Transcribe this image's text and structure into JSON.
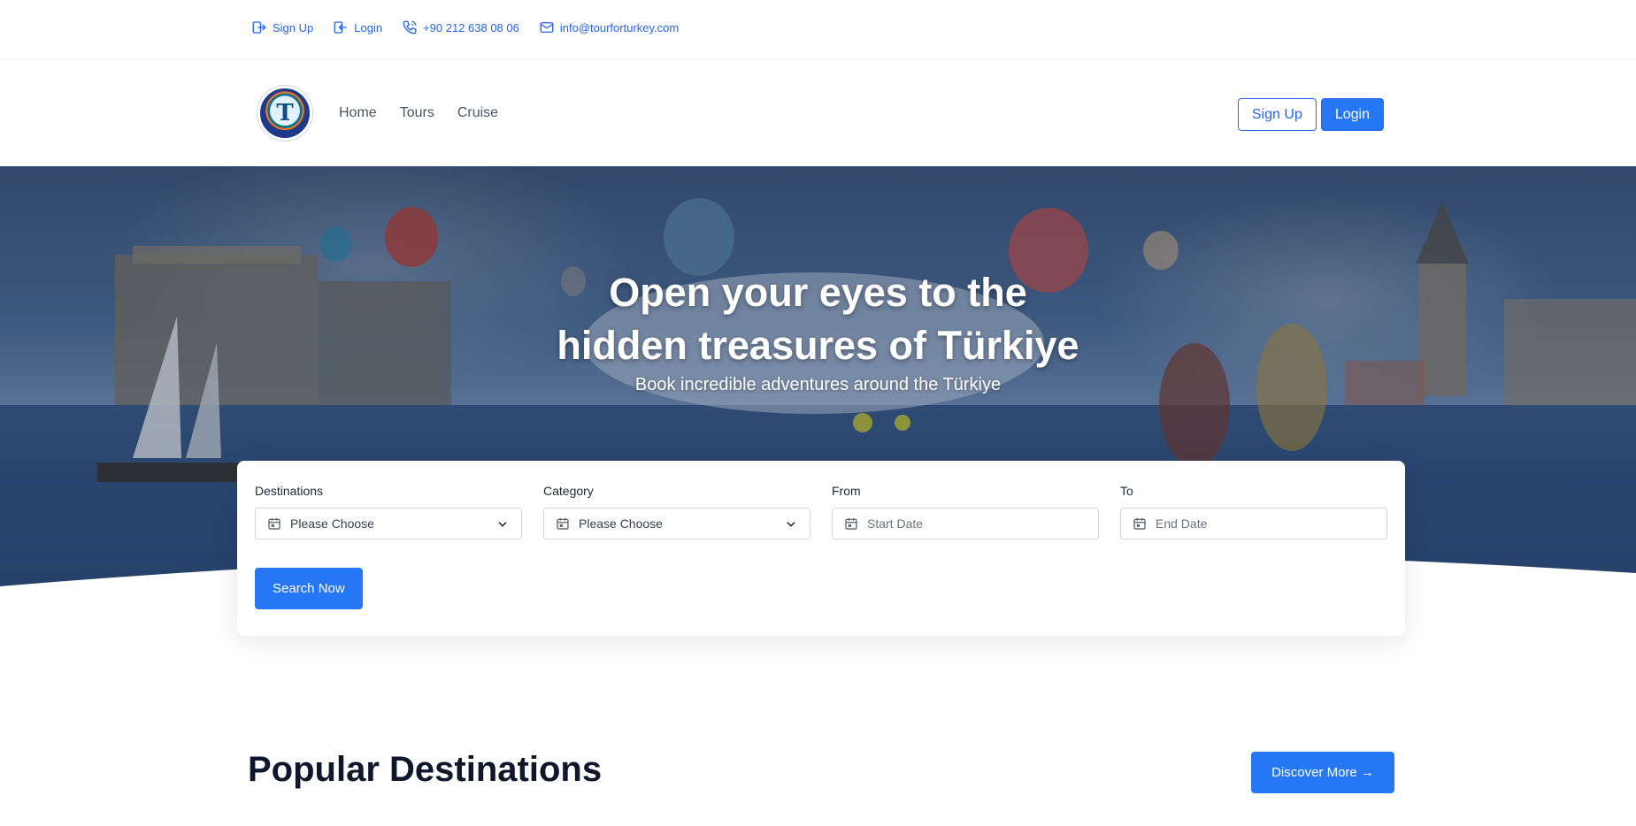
{
  "topbar": {
    "signup": "Sign Up",
    "login": "Login",
    "phone": "+90 212 638 08 06",
    "email": "info@tourforturkey.com"
  },
  "header": {
    "logo_letter": "T",
    "nav": [
      "Home",
      "Tours",
      "Cruise"
    ],
    "signup_button": "Sign Up",
    "login_button": "Login"
  },
  "hero": {
    "title_line1": "Open your eyes to the",
    "title_line2": "hidden treasures of Türkiye",
    "subtitle": "Book incredible adventures around the Türkiye"
  },
  "search": {
    "fields": [
      {
        "label": "Destinations",
        "value": "Please Choose"
      },
      {
        "label": "Category",
        "value": "Please Choose"
      },
      {
        "label": "From",
        "placeholder": "Start Date"
      },
      {
        "label": "To",
        "placeholder": "End Date"
      }
    ],
    "button": "Search Now"
  },
  "popular": {
    "title": "Popular Destinations",
    "discover_button": "Discover More →"
  },
  "colors": {
    "accent": "#2577f5",
    "link": "#2563eb",
    "heading": "#0f172a"
  }
}
